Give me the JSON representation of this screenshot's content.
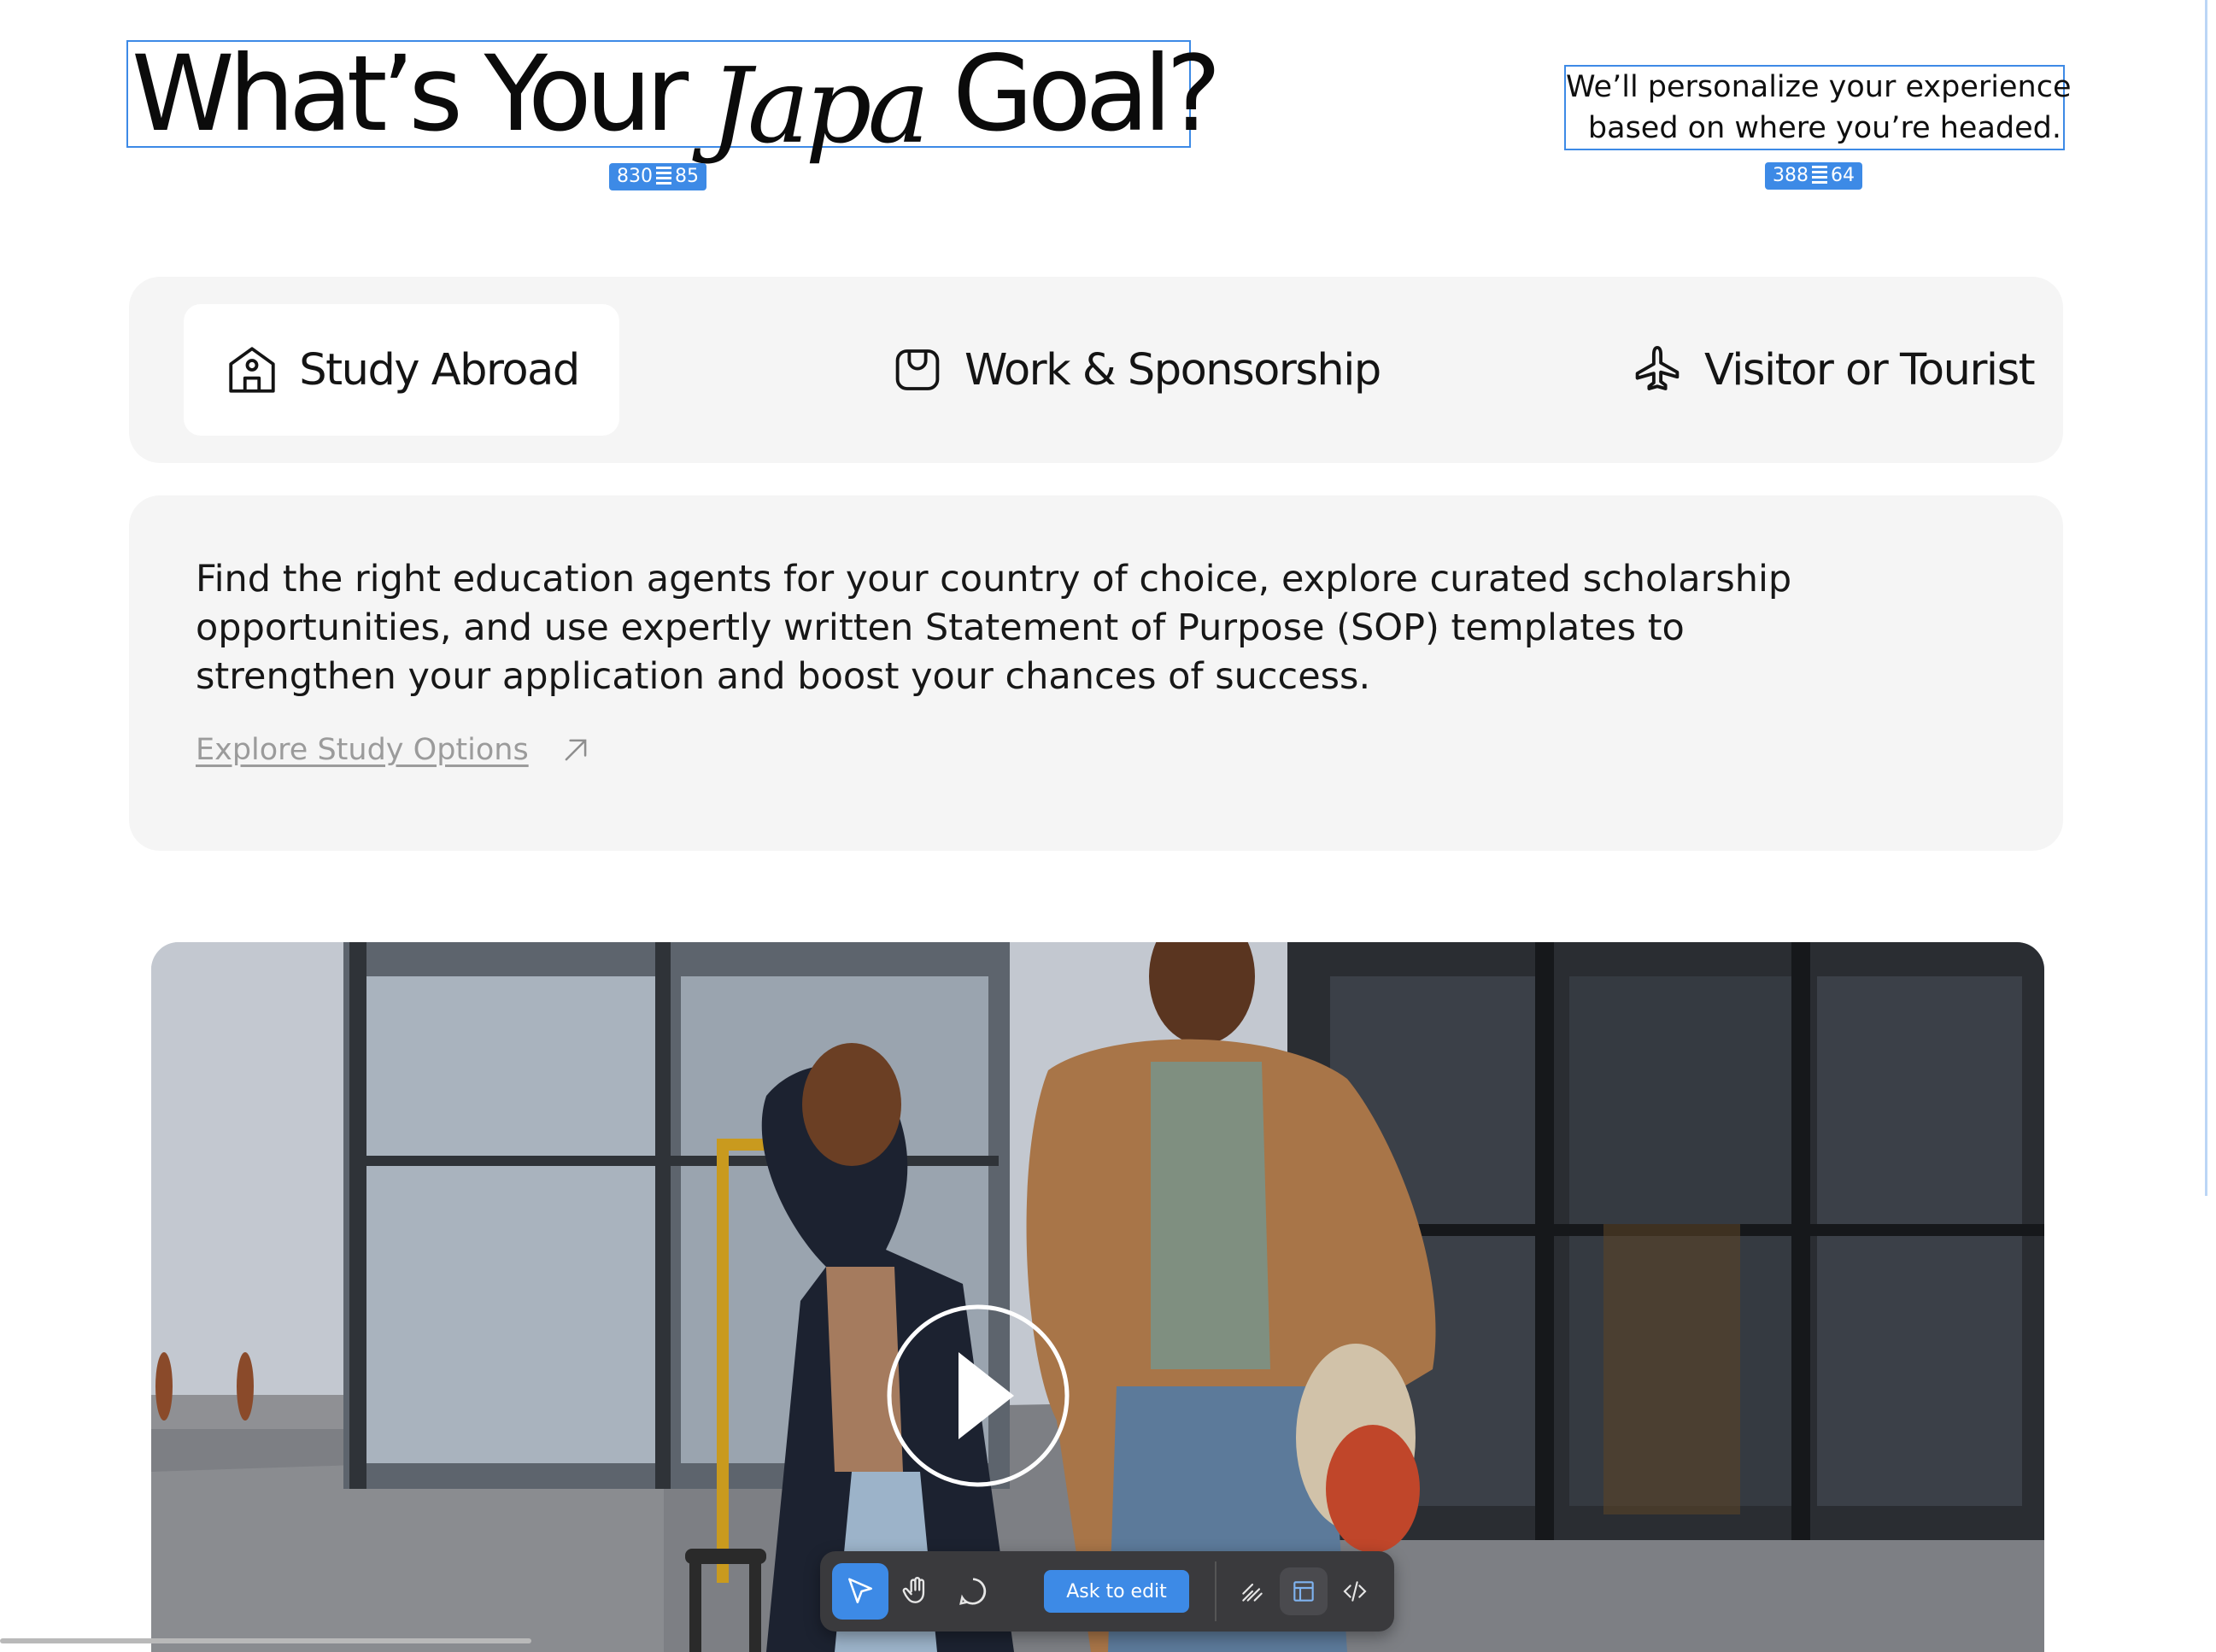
{
  "header": {
    "title_pre": "What’s Your ",
    "title_accent": "Japa",
    "title_post": " Goal?",
    "title_badge_w": "830",
    "title_badge_h": "85",
    "subtitle_line1": "We’ll personalize your experience",
    "subtitle_line2": "based on where you’re headed.",
    "subtitle_badge_w": "388",
    "subtitle_badge_h": "64"
  },
  "tabs": [
    {
      "label": "Study Abroad",
      "icon": "school-icon",
      "active": true
    },
    {
      "label": "Work & Sponsorship",
      "icon": "briefcase-icon",
      "active": false
    },
    {
      "label": "Visitor or Tourist",
      "icon": "airplane-icon",
      "active": false
    }
  ],
  "description": {
    "text": "Find the right education agents for your country of choice, explore curated scholarship opportunities, and use expertly written Statement of Purpose (SOP) templates to strengthen your application and boost your chances of success.",
    "link_label": "Explore Study Options",
    "link_icon": "arrow-up-right-icon"
  },
  "media": {
    "play_icon": "play-icon"
  },
  "toolbar": {
    "select_icon": "cursor-icon",
    "hand_icon": "hand-icon",
    "comment_icon": "comment-icon",
    "ask_label": "Ask to edit",
    "draw_icon": "draw-icon",
    "inspect_icon": "inspect-icon",
    "code_icon": "code-icon"
  },
  "colors": {
    "accent": "#3d8ae6",
    "panel": "#f5f5f5",
    "toolbar": "#3a3a3d"
  }
}
